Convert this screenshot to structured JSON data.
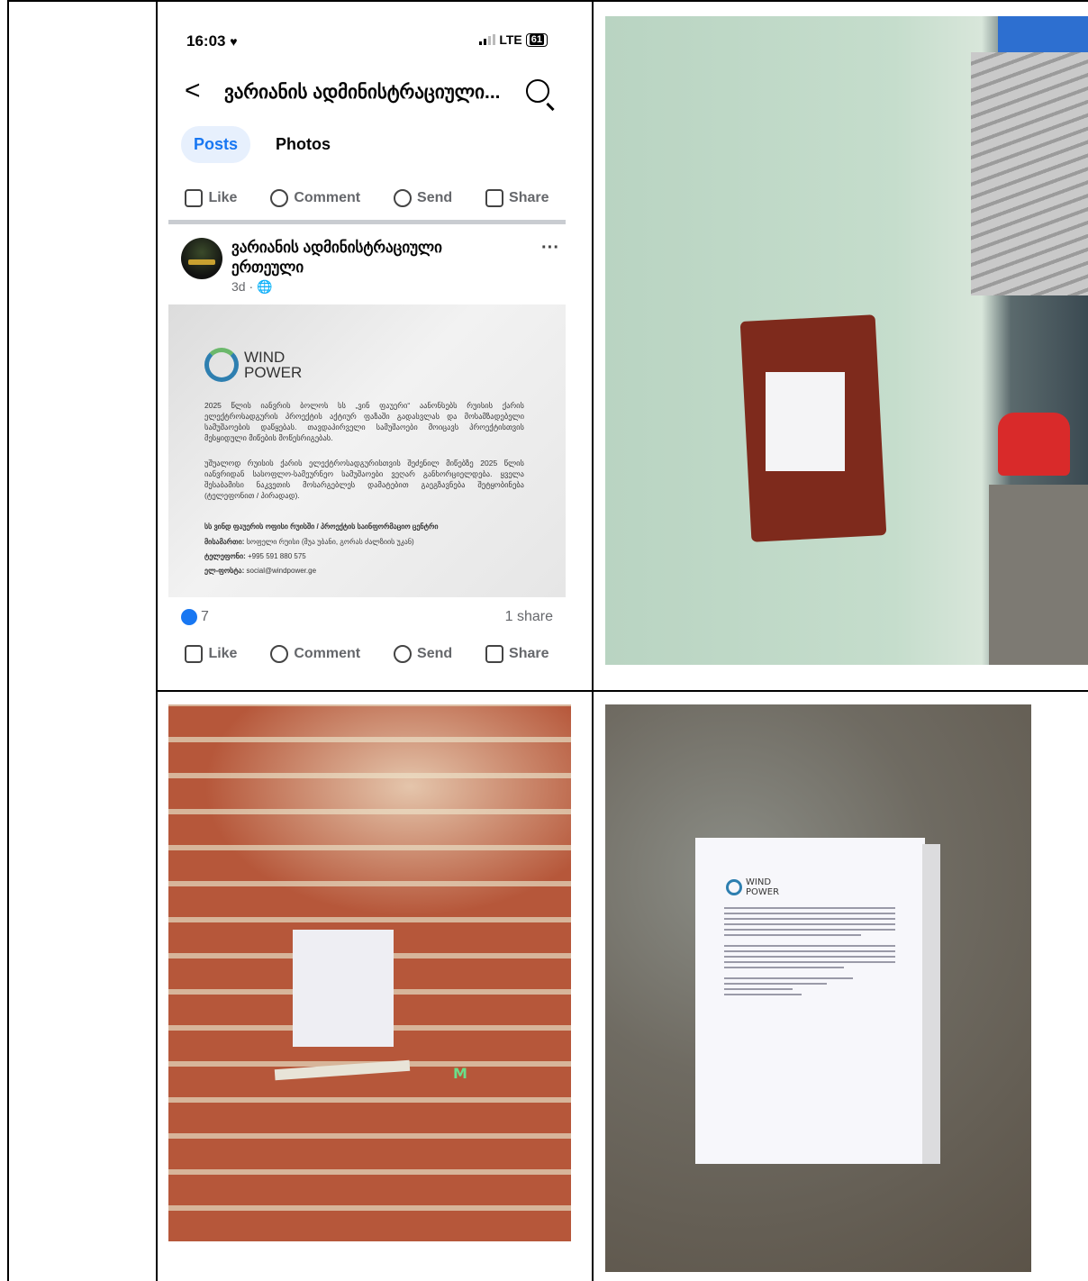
{
  "phone": {
    "time": "16:03",
    "network": "LTE",
    "battery": "61",
    "nav_title": "ვარიანის ადმინისტრაციული...",
    "tabs": [
      "Posts",
      "Photos"
    ],
    "actions": [
      "Like",
      "Comment",
      "Send",
      "Share"
    ],
    "post": {
      "author": "ვარიანის ადმინისტრაციული ერთეული",
      "meta": "3d · ",
      "more": "···",
      "reactions": "7",
      "shares": "1 share"
    },
    "image": {
      "logo_line1": "WIND",
      "logo_line2": "POWER",
      "paragraph1": "2025 წლის იანვრის ბოლოს სს „ვინ ფაუერი“ აანონსებს რუისის ქარის ელექტროსადგურის პროექტის აქტიურ ფაზაში გადასვლას და მოსამზადებელი სამუშაოების დაწყებას. თავდაპირველი სამუშაოები მოიცავს პროექტისთვის მესყიდული მიწების მოწესრიგებას.",
      "paragraph2": "უშუალოდ რუისის ქარის ელექტროსადგურისთვის შეძენილ მიწებზე 2025 წლის იანვრიდან სასოფლო-სამეურნეო სამუშაოები ვეღარ განხორციელდება. ყველა შესაბამისი ნაკვეთის მოსარგებლეს დამატებით გაეგზავნება შეტყობინება (ტელეფონით / პირადად).",
      "center": "სს ვინდ ფაუერის ოფისი რუისში / პროექტის საინფორმაციო ცენტრი",
      "address_label": "მისამართი:",
      "address": "სოფელი რუისი (შუა უბანი, გორას ძალზიის უკან)",
      "phone_label": "ტელეფონი:",
      "phone": "+995 591 880 575",
      "email_label": "ელ-ფოსტა:",
      "email": "social@windpower.ge"
    }
  },
  "photo_poster": {
    "logo_line1": "WIND",
    "logo_line2": "POWER"
  },
  "colors": {
    "facebook_blue": "#1877f2",
    "border": "#000000"
  }
}
